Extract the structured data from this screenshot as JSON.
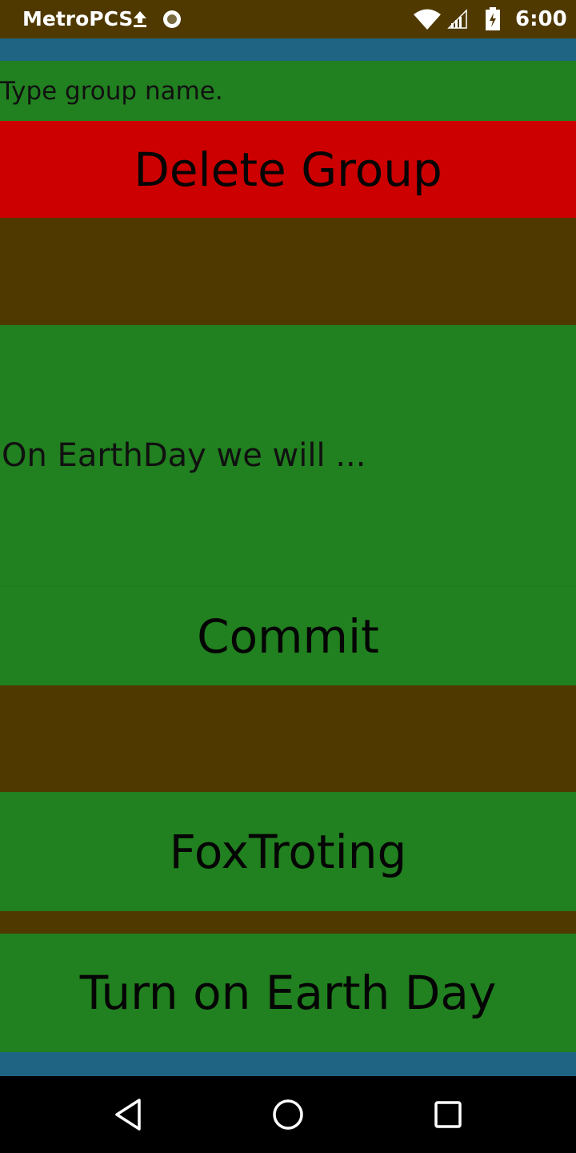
{
  "status_bar": {
    "carrier": "MetroPCS",
    "time": "6:00",
    "icons": [
      "upload-icon",
      "record-icon",
      "wifi-icon",
      "signal-icon",
      "battery-icon"
    ]
  },
  "group_name": {
    "value": "",
    "placeholder": "Type group name."
  },
  "buttons": {
    "delete_group": "Delete Group",
    "commit": "Commit",
    "foxtroting": "FoxTroting",
    "turn_on_earth_day": "Turn on Earth Day"
  },
  "pledge": {
    "value": "",
    "placeholder": "On EarthDay we will ..."
  },
  "nav": {
    "icons": [
      "back-icon",
      "home-icon",
      "recent-apps-icon"
    ]
  },
  "colors": {
    "background": "#4f3900",
    "green": "#21801f",
    "red": "#cc0000",
    "blue": "#1f6482"
  }
}
